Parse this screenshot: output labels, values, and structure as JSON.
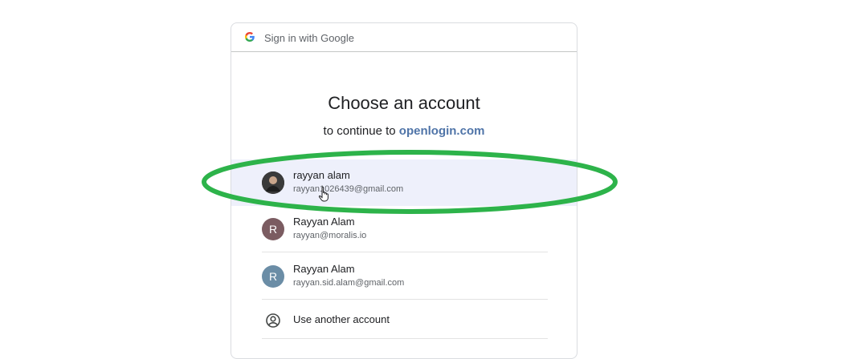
{
  "header": {
    "text": "Sign in with Google",
    "logo_icon": "google-g-icon"
  },
  "main": {
    "title": "Choose an account",
    "subtitle_prefix": "to continue to ",
    "subtitle_domain": "openlogin.com",
    "domain_color": "#4f74a8"
  },
  "accounts": [
    {
      "name": "rayyan alam",
      "email": "rayyan1026439@gmail.com",
      "avatar_icon": "profile-photo",
      "avatar_color": "#3c3c3c",
      "selected": true
    },
    {
      "name": "Rayyan Alam",
      "email": "rayyan@moralis.io",
      "avatar_initial": "R",
      "avatar_color": "#7b5c61",
      "selected": false
    },
    {
      "name": "Rayyan Alam",
      "email": "rayyan.sid.alam@gmail.com",
      "avatar_initial": "R",
      "avatar_color": "#6b8da6",
      "selected": false
    }
  ],
  "another": {
    "label": "Use another account",
    "icon": "account-circle-icon"
  },
  "overlay": {
    "highlight_color": "#2db34a",
    "cursor_icon": "hand-pointer-icon"
  }
}
